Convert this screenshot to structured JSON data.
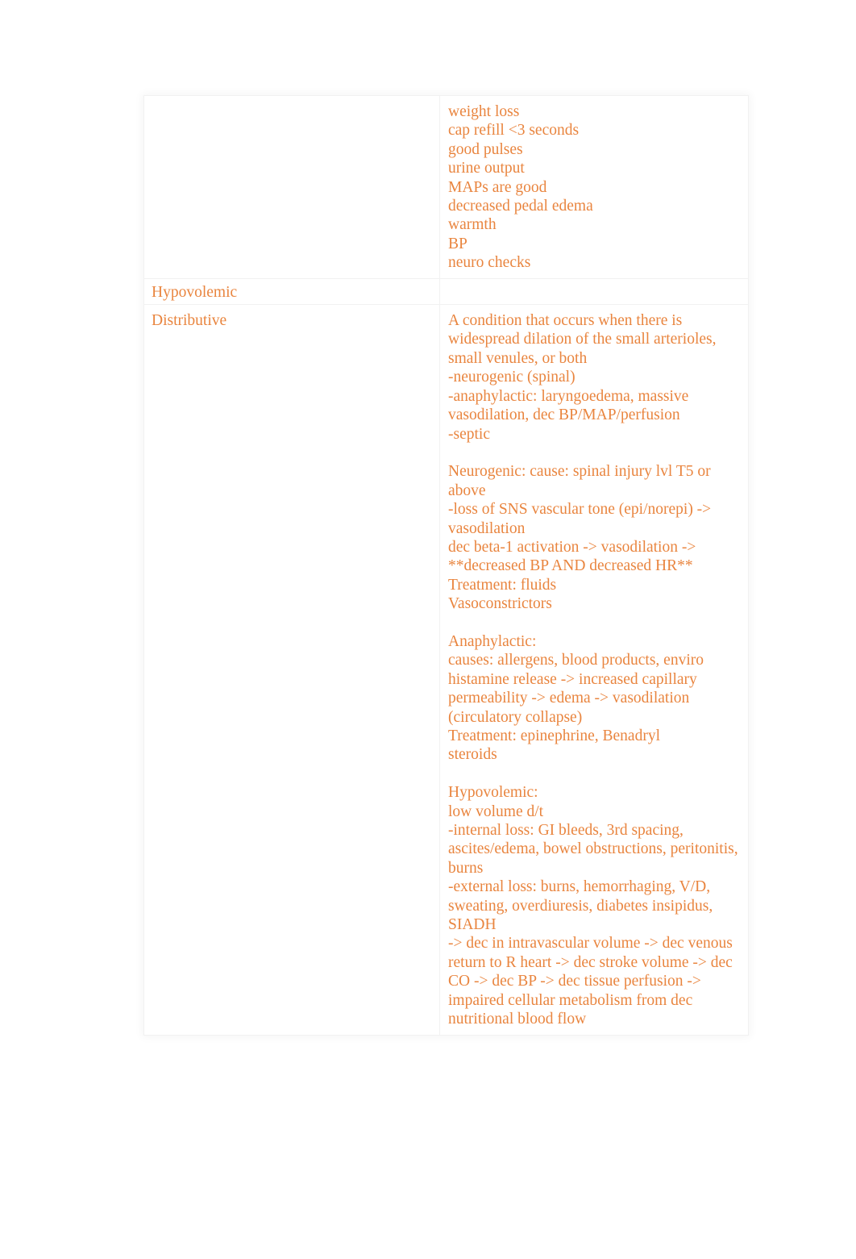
{
  "document": {
    "type": "study-notes-table",
    "text_color": "#e9853f",
    "background_color": "#ffffff",
    "border_color": "#f1f1f1"
  },
  "table": {
    "rows": [
      {
        "id": "row-assessment-findings",
        "left": "",
        "right": "weight loss\ncap refill <3 seconds\ngood pulses\nurine output\nMAPs are good\ndecreased pedal edema\nwarmth\nBP\nneuro checks"
      },
      {
        "id": "row-hypovolemic-label",
        "left": "Hypovolemic",
        "right": ""
      },
      {
        "id": "row-distributive",
        "left": "Distributive",
        "right": "A condition that occurs when there is widespread dilation of the small arterioles, small venules, or both\n-neurogenic (spinal)\n-anaphylactic: laryngoedema, massive vasodilation, dec BP/MAP/perfusion\n-septic\n\nNeurogenic: cause: spinal injury lvl T5 or above\n-loss of SNS vascular tone (epi/norepi) -> vasodilation\ndec beta-1 activation -> vasodilation ->\n**decreased BP AND decreased HR**\nTreatment: fluids\nVasoconstrictors\n\nAnaphylactic:\ncauses: allergens, blood products, enviro\nhistamine release -> increased capillary permeability -> edema -> vasodilation (circulatory collapse)\nTreatment: epinephrine, Benadryl\nsteroids\n\nHypovolemic:\nlow volume d/t\n-internal loss: GI bleeds, 3rd spacing, ascites/edema, bowel obstructions, peritonitis, burns\n-external loss: burns, hemorrhaging, V/D, sweating, overdiuresis, diabetes insipidus, SIADH\n-> dec in intravascular volume -> dec venous return to R heart -> dec stroke volume -> dec CO -> dec BP -> dec tissue perfusion -> impaired cellular metabolism from dec nutritional blood flow"
      }
    ]
  }
}
